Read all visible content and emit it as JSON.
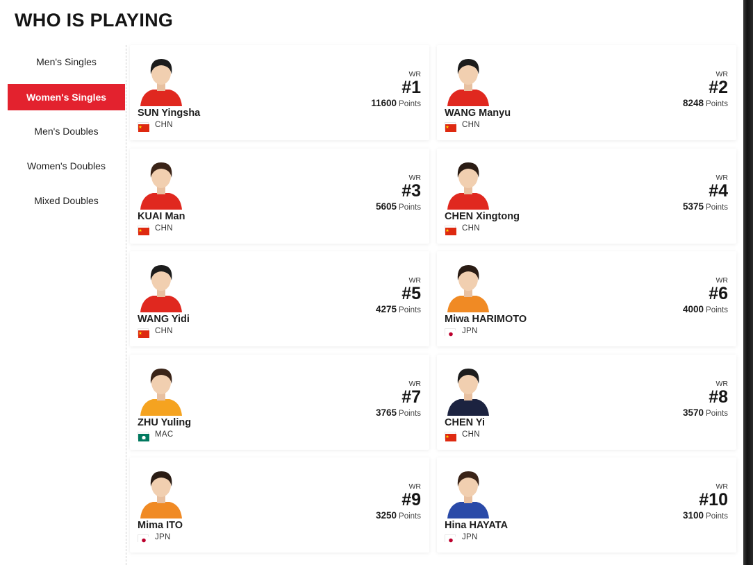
{
  "page": {
    "title": "WHO IS PLAYING"
  },
  "sidebar": {
    "items": [
      {
        "label": "Men's Singles",
        "active": false
      },
      {
        "label": "Women's Singles",
        "active": true
      },
      {
        "label": "Men's Doubles",
        "active": false
      },
      {
        "label": "Women's Doubles",
        "active": false
      },
      {
        "label": "Mixed Doubles",
        "active": false
      }
    ]
  },
  "colors": {
    "accent": "#e3222e",
    "card_bg": "#ffffff"
  },
  "players": [
    {
      "name": "SUN Yingsha",
      "country": "CHN",
      "flag": "china-flag-icon",
      "wr_label": "WR",
      "rank": "#1",
      "points": "11600",
      "points_label": "Points",
      "shirt": "#e0281f",
      "hair": "#1c1c1c"
    },
    {
      "name": "WANG Manyu",
      "country": "CHN",
      "flag": "china-flag-icon",
      "wr_label": "WR",
      "rank": "#2",
      "points": "8248",
      "points_label": "Points",
      "shirt": "#e0281f",
      "hair": "#1c1c1c"
    },
    {
      "name": "KUAI Man",
      "country": "CHN",
      "flag": "china-flag-icon",
      "wr_label": "WR",
      "rank": "#3",
      "points": "5605",
      "points_label": "Points",
      "shirt": "#e0281f",
      "hair": "#3a2418"
    },
    {
      "name": "CHEN Xingtong",
      "country": "CHN",
      "flag": "china-flag-icon",
      "wr_label": "WR",
      "rank": "#4",
      "points": "5375",
      "points_label": "Points",
      "shirt": "#e0281f",
      "hair": "#2a1c14"
    },
    {
      "name": "WANG Yidi",
      "country": "CHN",
      "flag": "china-flag-icon",
      "wr_label": "WR",
      "rank": "#5",
      "points": "4275",
      "points_label": "Points",
      "shirt": "#e0281f",
      "hair": "#1c1c1c"
    },
    {
      "name": "Miwa HARIMOTO",
      "country": "JPN",
      "flag": "japan-flag-icon",
      "wr_label": "WR",
      "rank": "#6",
      "points": "4000",
      "points_label": "Points",
      "shirt": "#f08a24",
      "hair": "#2a1c14"
    },
    {
      "name": "ZHU Yuling",
      "country": "MAC",
      "flag": "macau-flag-icon",
      "wr_label": "WR",
      "rank": "#7",
      "points": "3765",
      "points_label": "Points",
      "shirt": "#f5a320",
      "hair": "#3a2418"
    },
    {
      "name": "CHEN Yi",
      "country": "CHN",
      "flag": "china-flag-icon",
      "wr_label": "WR",
      "rank": "#8",
      "points": "3570",
      "points_label": "Points",
      "shirt": "#1c2340",
      "hair": "#1c1c1c"
    },
    {
      "name": "Mima ITO",
      "country": "JPN",
      "flag": "japan-flag-icon",
      "wr_label": "WR",
      "rank": "#9",
      "points": "3250",
      "points_label": "Points",
      "shirt": "#f08a24",
      "hair": "#2a1c14"
    },
    {
      "name": "Hina HAYATA",
      "country": "JPN",
      "flag": "japan-flag-icon",
      "wr_label": "WR",
      "rank": "#10",
      "points": "3100",
      "points_label": "Points",
      "shirt": "#2a4aa8",
      "hair": "#3a2418"
    }
  ]
}
